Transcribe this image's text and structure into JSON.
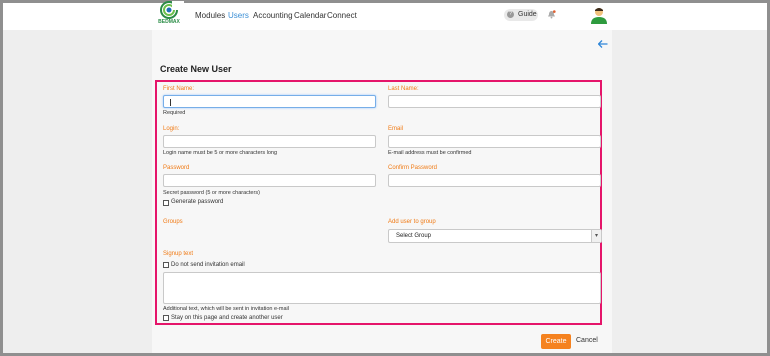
{
  "header": {
    "logo_text": "BEDMAX",
    "nav": [
      "Modules",
      "Users",
      "Accounting",
      "Calendar",
      "Connect"
    ],
    "active_nav": "Users",
    "guide_label": "Guide",
    "guide_icon": "?"
  },
  "form": {
    "title": "Create New User",
    "first_name": {
      "label": "First Name:",
      "value": "",
      "help": "Required"
    },
    "last_name": {
      "label": "Last Name:",
      "value": ""
    },
    "login": {
      "label": "Login:",
      "value": "",
      "help": "Login name must be 5 or more characters long"
    },
    "email": {
      "label": "Email",
      "value": "",
      "help": "E-mail address must be confirmed"
    },
    "password": {
      "label": "Password",
      "value": "",
      "help": "Secret password (5 or more characters)"
    },
    "confirm_password": {
      "label": "Confirm Password",
      "value": ""
    },
    "generate_password": {
      "label": "Generate password",
      "checked": false
    },
    "groups": {
      "label": "Groups"
    },
    "add_to_group": {
      "label": "Add user to group",
      "selected": "Select Group"
    },
    "signup": {
      "label": "Signup text",
      "no_email": {
        "label": "Do not send invitation email",
        "checked": false
      },
      "value": "",
      "help": "Additional text, which will be sent in invitation e-mail"
    },
    "stay_on_page": {
      "label": "Stay on this page and create another user",
      "checked": false
    }
  },
  "actions": {
    "create": "Create",
    "cancel": "Cancel"
  },
  "colors": {
    "accent": "#f5821f",
    "label": "#f07a14",
    "highlight": "#e5156a",
    "link": "#3a8fd6"
  }
}
